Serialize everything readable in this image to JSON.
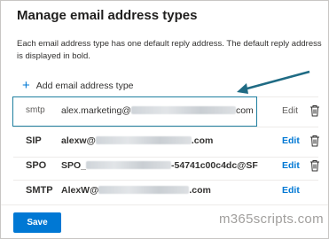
{
  "panel": {
    "title": "Manage email address types",
    "description": "Each email address type has one default reply address. The default reply address is displayed in bold."
  },
  "add_button": {
    "icon": "plus-icon",
    "label": "Add email address type"
  },
  "rows": [
    {
      "type": "smtp",
      "address_prefix": "alex.marketing@",
      "address_suffix": "com",
      "edit_label": "Edit",
      "delete_icon": "trash-icon",
      "bold": false
    },
    {
      "type": "SIP",
      "address_prefix": "alexw@",
      "address_suffix": ".com",
      "edit_label": "Edit",
      "delete_icon": "trash-icon",
      "bold": true
    },
    {
      "type": "SPO",
      "address_prefix": "SPO_",
      "address_suffix": "-54741c00c4dc@SF",
      "edit_label": "Edit",
      "delete_icon": "trash-icon",
      "bold": true
    },
    {
      "type": "SMTP",
      "address_prefix": "AlexW@",
      "address_suffix": ".com",
      "edit_label": "Edit",
      "delete_icon": null,
      "bold": true
    }
  ],
  "footer": {
    "save_label": "Save"
  },
  "watermark": "m365scripts.com",
  "colors": {
    "accent": "#0078d4",
    "highlight_border": "#1f7fa0",
    "arrow": "#1f6b84"
  }
}
